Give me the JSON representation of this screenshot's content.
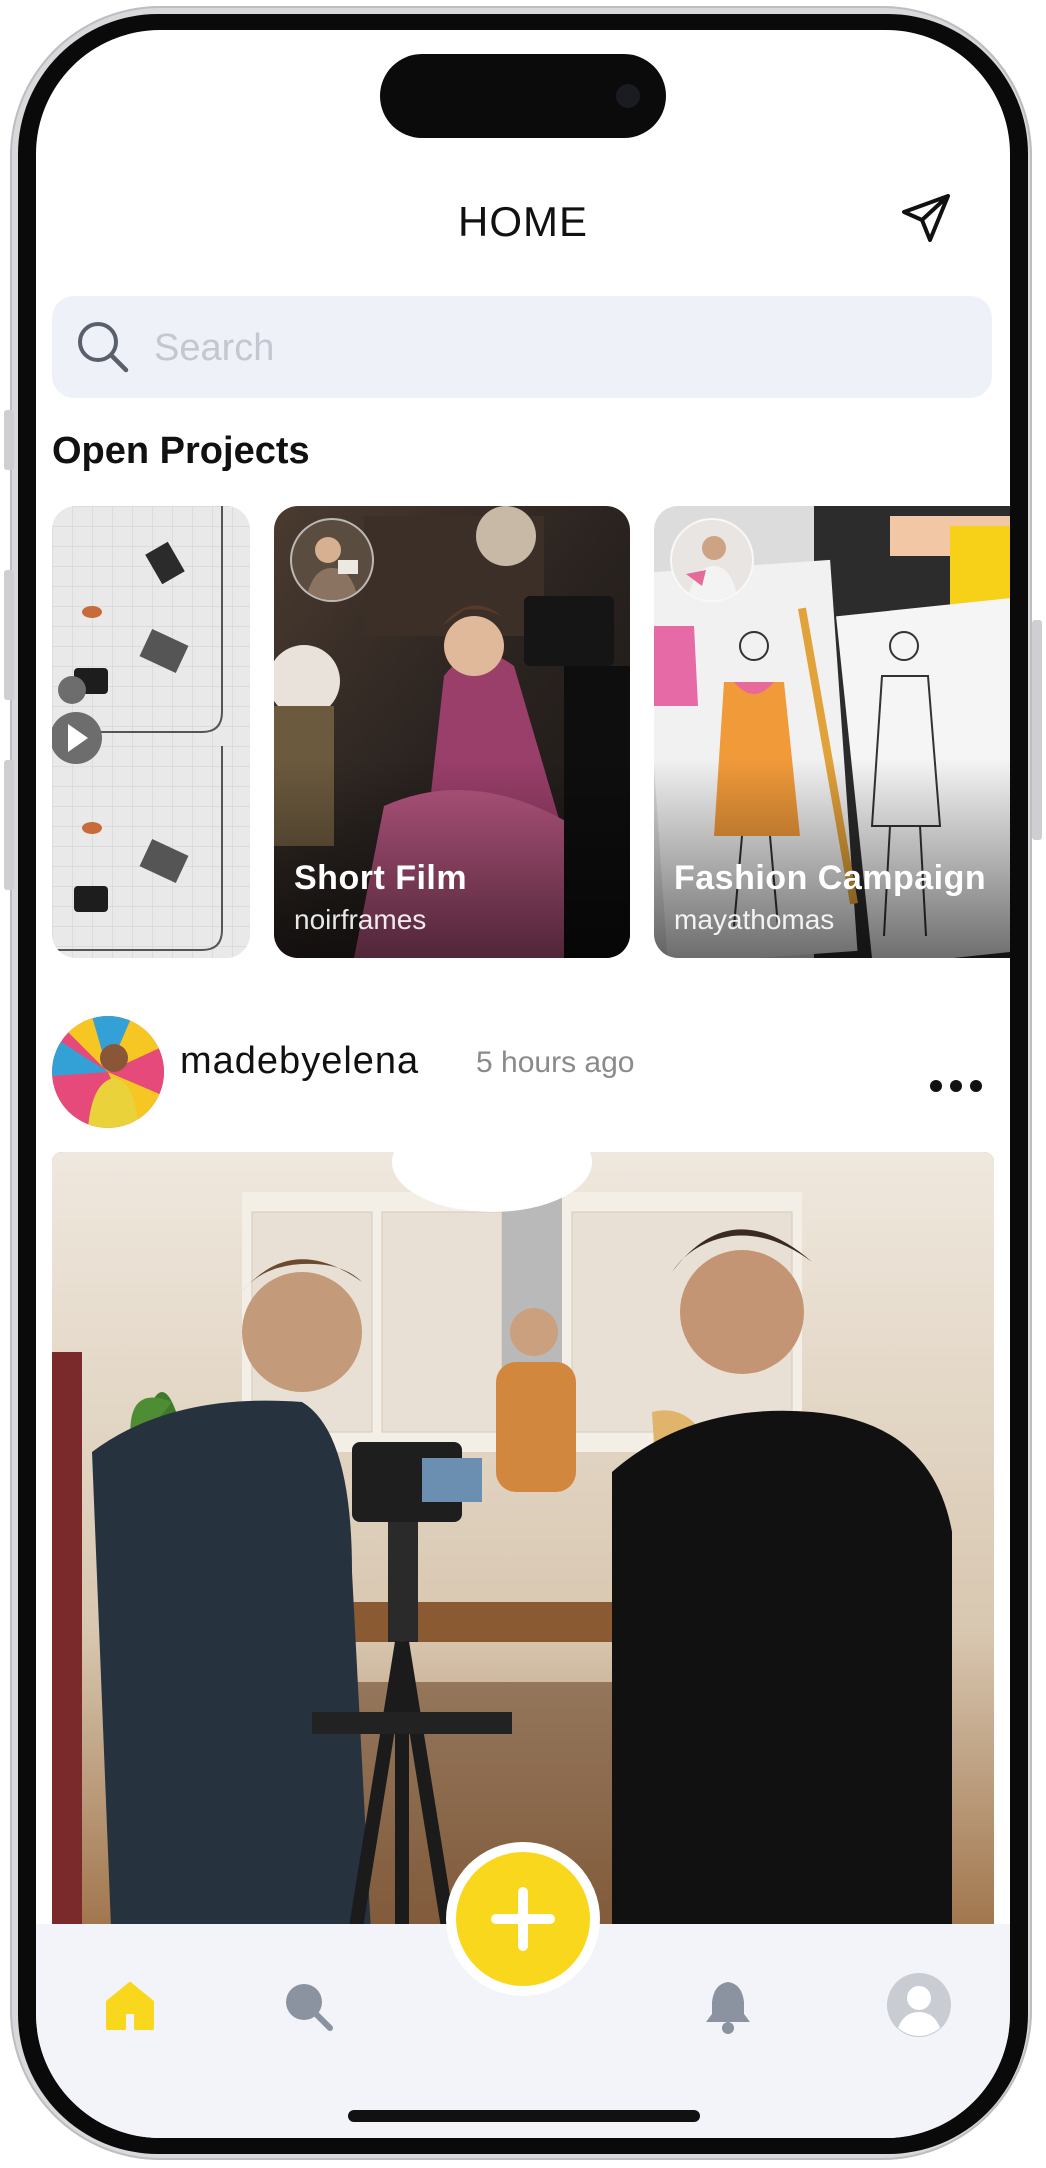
{
  "header": {
    "title": "HOME"
  },
  "search": {
    "placeholder": "Search"
  },
  "open_projects": {
    "title": "Open Projects",
    "cards": [
      {
        "title": "",
        "user": ""
      },
      {
        "title": "Short Film",
        "user": "noirframes"
      },
      {
        "title": "Fashion Campaign",
        "user": "mayathomas"
      }
    ]
  },
  "post": {
    "username": "madebyelena",
    "time": "5 hours ago"
  },
  "colors": {
    "accent": "#f9d71c",
    "search_bg": "#eef1f8",
    "nav_bg": "#f2f4f9",
    "icon_gray": "#8b93a1"
  },
  "icons": {
    "send": "send-icon",
    "search": "search-icon",
    "more": "more-icon",
    "home": "home-icon",
    "explore": "search-icon",
    "add": "plus-icon",
    "notifications": "bell-icon",
    "profile": "avatar-icon"
  }
}
